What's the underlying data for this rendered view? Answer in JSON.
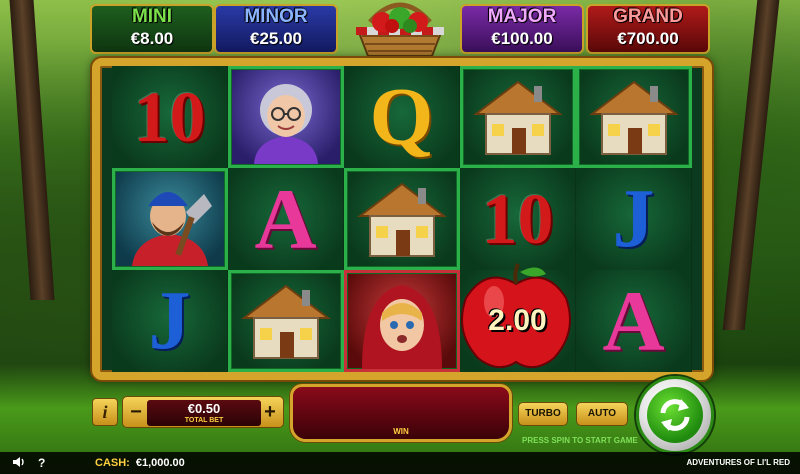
{
  "jackpots": {
    "mini": {
      "label": "MINI",
      "value": "€8.00",
      "label_color": "#7be04a"
    },
    "minor": {
      "label": "MINOR",
      "value": "€25.00",
      "label_color": "#8ab4ff"
    },
    "major": {
      "label": "MAJOR",
      "value": "€100.00",
      "label_color": "#f0a8ff"
    },
    "grand": {
      "label": "GRAND",
      "value": "€700.00",
      "label_color": "#ff9a9a"
    }
  },
  "reels": {
    "rows": [
      [
        "10",
        "grandma",
        "Q",
        "cottage",
        "cottage"
      ],
      [
        "woodcutter",
        "A",
        "cottage",
        "10",
        "J"
      ],
      [
        "J",
        "cottage",
        "red-riding-hood",
        "apple",
        "A"
      ]
    ],
    "apple_value": "2.00"
  },
  "controls": {
    "info_label": "i",
    "bet_minus": "−",
    "bet_plus": "+",
    "bet_value": "€0.50",
    "bet_label": "TOTAL BET",
    "win_label": "WIN",
    "turbo_label": "TURBO",
    "auto_label": "AUTO",
    "spin_hint": "PRESS SPIN TO START GAME"
  },
  "status": {
    "cash_label": "CASH:",
    "cash_value": "€1,000.00",
    "game_title": "ADVENTURES OF LI'L RED",
    "help_label": "?"
  },
  "colors": {
    "frame_gold": "#d4a52a",
    "spin_green": "#2a8a14",
    "win_red": "#8a0a1a"
  }
}
